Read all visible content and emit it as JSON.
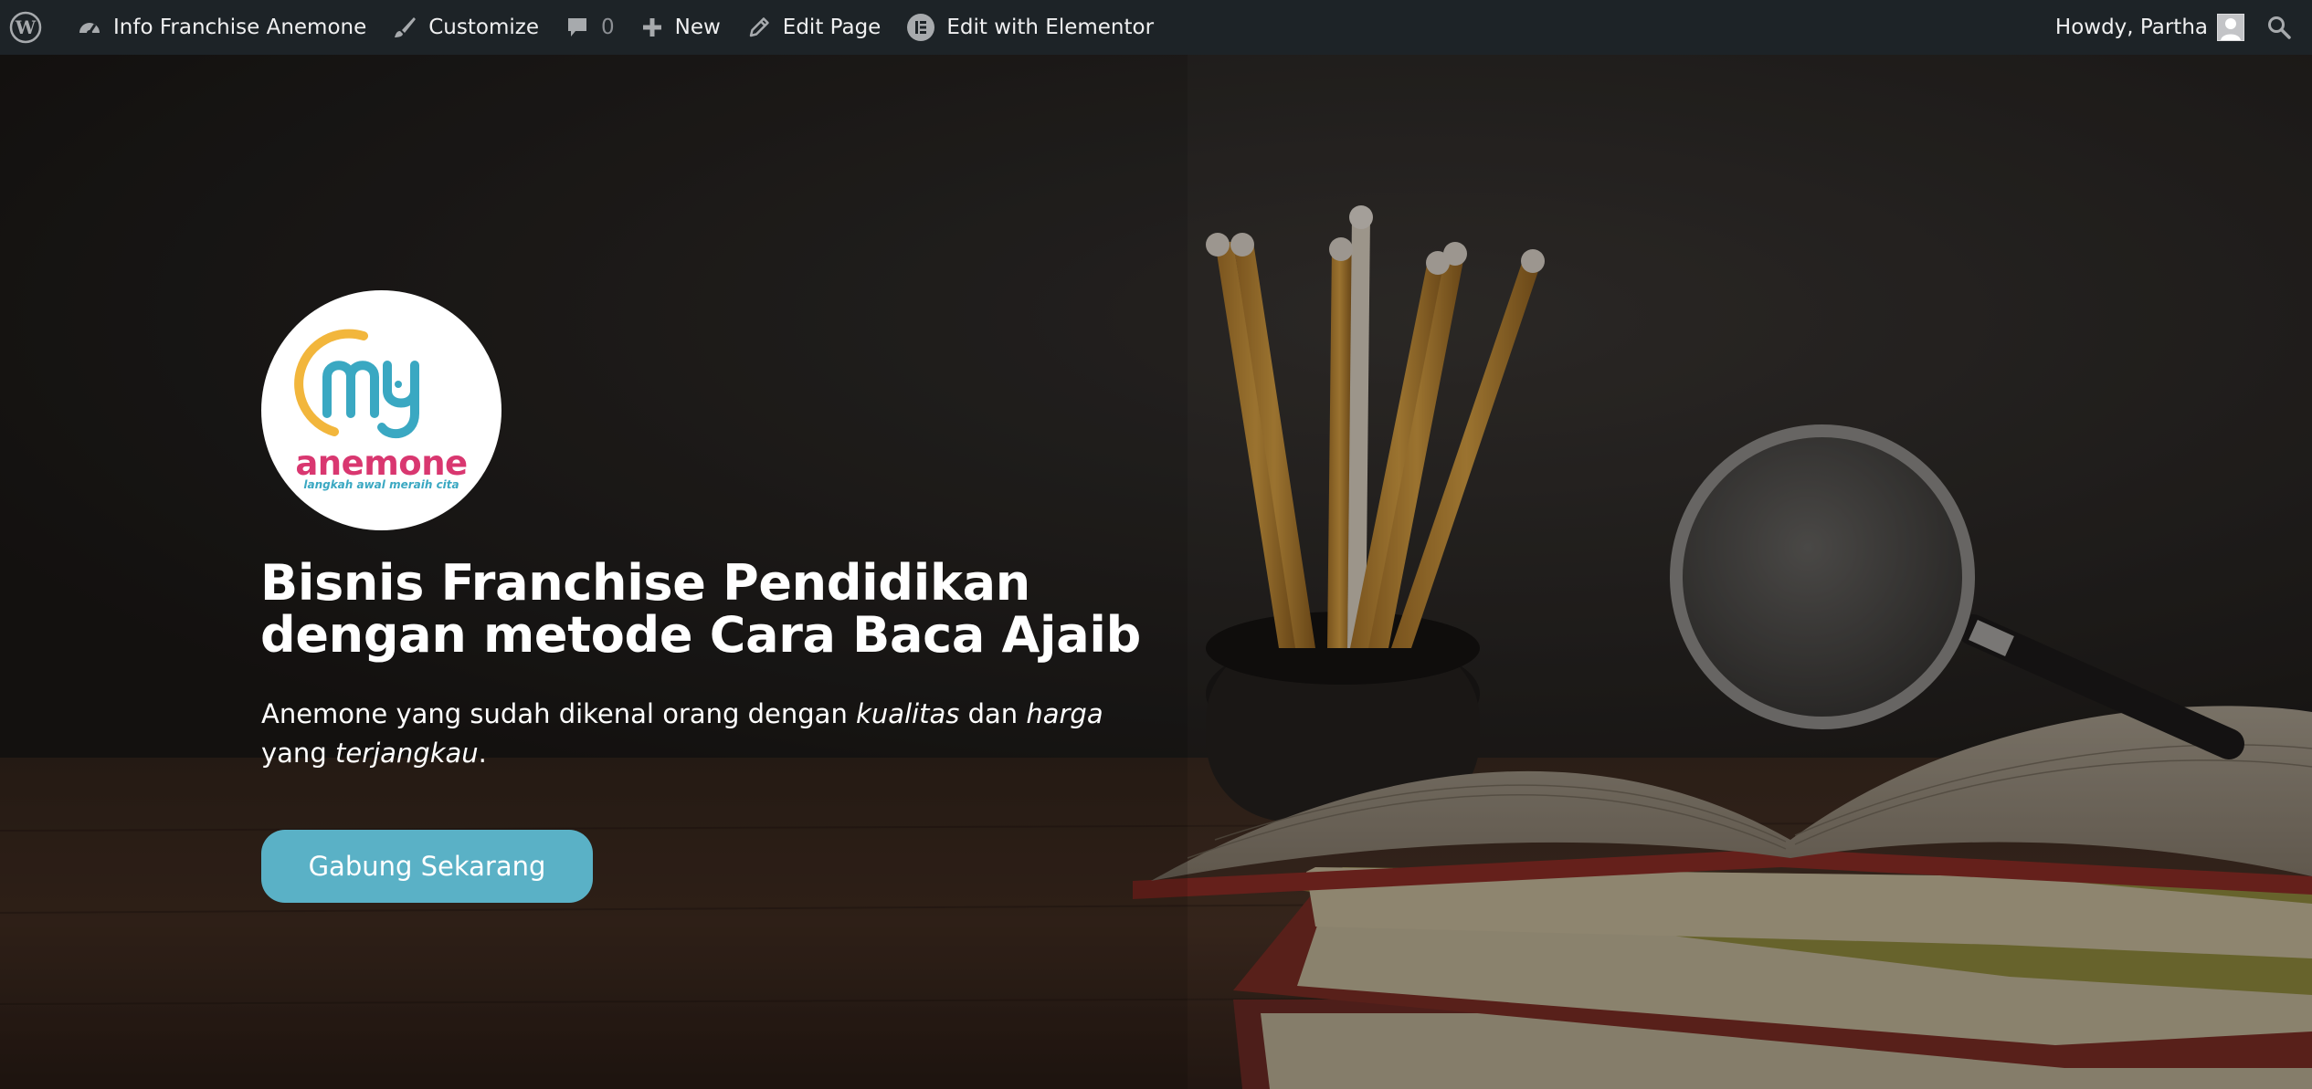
{
  "adminbar": {
    "site_name": "Info Franchise Anemone",
    "customize_label": "Customize",
    "comments_count": "0",
    "new_label": "New",
    "edit_page_label": "Edit Page",
    "elementor_label": "Edit with Elementor",
    "howdy_label": "Howdy, Partha",
    "icons": [
      "wordpress-icon",
      "dashboard-icon",
      "brush-icon",
      "comment-icon",
      "plus-icon",
      "pencil-icon",
      "elementor-icon",
      "avatar",
      "search-icon"
    ]
  },
  "hero": {
    "logo": {
      "brand": "anemone",
      "tagline": "langkah awal meraih cita"
    },
    "title_line1": "Bisnis Franchise Pendidikan",
    "title_line2": "dengan metode Cara Baca Ajaib",
    "subtitle": {
      "part1": "Anemone yang sudah dikenal orang dengan ",
      "em1": "kualitas",
      "part2": " dan ",
      "em2": "harga",
      "part3": " yang ",
      "em3": "terjangkau",
      "part4": "."
    },
    "cta_label": "Gabung Sekarang"
  },
  "colors": {
    "adminbar_bg": "#1d2327",
    "cta_bg": "#5ab1c6",
    "logo_pink": "#d93770",
    "logo_blue": "#3aa8c2",
    "logo_yellow": "#f2b63c"
  }
}
